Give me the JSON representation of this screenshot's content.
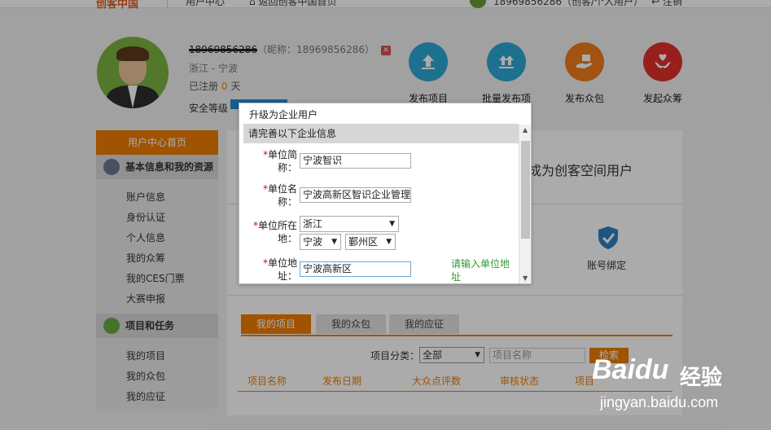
{
  "topbar": {
    "logo": "创客中国",
    "link_user_center": "用户中心",
    "link_back": "返回创客中国首页",
    "user_info": "18969856286（创客/个人用户）",
    "logout": "注销"
  },
  "profile": {
    "phone": "18969856286",
    "nickname": "（昵称：18969856286）",
    "region": "浙江 - 宁波",
    "registered_prefix": "已注册",
    "registered_days": "0",
    "registered_suffix": "天",
    "security_label": "安全等级"
  },
  "actions": [
    {
      "label": "发布项目",
      "icon": "upload-icon",
      "color": "#2ea7d6"
    },
    {
      "label": "批量发布项",
      "icon": "batch-upload-icon",
      "color": "#2ea7d6"
    },
    {
      "label": "发布众包",
      "icon": "hand-box-icon",
      "color": "#f07c1c"
    },
    {
      "label": "发起众筹",
      "icon": "hand-heart-icon",
      "color": "#e2302a"
    }
  ],
  "sidebar": {
    "home": "用户中心首页",
    "group1": "基本信息和我的资源",
    "group1_items": [
      "账户信息",
      "身份认证",
      "个人信息",
      "我的众筹",
      "我的CES门票",
      "大赛申报"
    ],
    "group2": "项目和任务",
    "group2_items": [
      "我的项目",
      "我的众包",
      "我的应征"
    ]
  },
  "main": {
    "heading": "成为创客空间用户",
    "bind_label": "账号绑定",
    "tabs": [
      "我的项目",
      "我的众包",
      "我的应征"
    ],
    "filter_label": "项目分类：",
    "filter_value": "全部",
    "search_placeholder": "项目名称",
    "search_button": "检索",
    "columns": [
      "项目名称",
      "发布日期",
      "大众点评数",
      "审核状态",
      "项目"
    ]
  },
  "modal": {
    "title": "升级为企业用户",
    "section": "请完善以下企业信息",
    "required_mark": "*",
    "short_name_label_1": "单位简",
    "short_name_label_2": "称：",
    "short_name_value": "宁波智识",
    "full_name_label_1": "单位名",
    "full_name_label_2": "称：",
    "full_name_value": "宁波高新区智识企业管理",
    "location_label_1": "单位所在",
    "location_label_2": "地：",
    "province": "浙江",
    "city": "宁波",
    "district": "鄞州区",
    "address_label_1": "单位地",
    "address_label_2": "址：",
    "address_value": "宁波高新区",
    "address_hint": "请输入单位地址"
  },
  "watermark": {
    "brand": "Baidu",
    "product": "经验",
    "url": "jingyan.baidu.com"
  }
}
